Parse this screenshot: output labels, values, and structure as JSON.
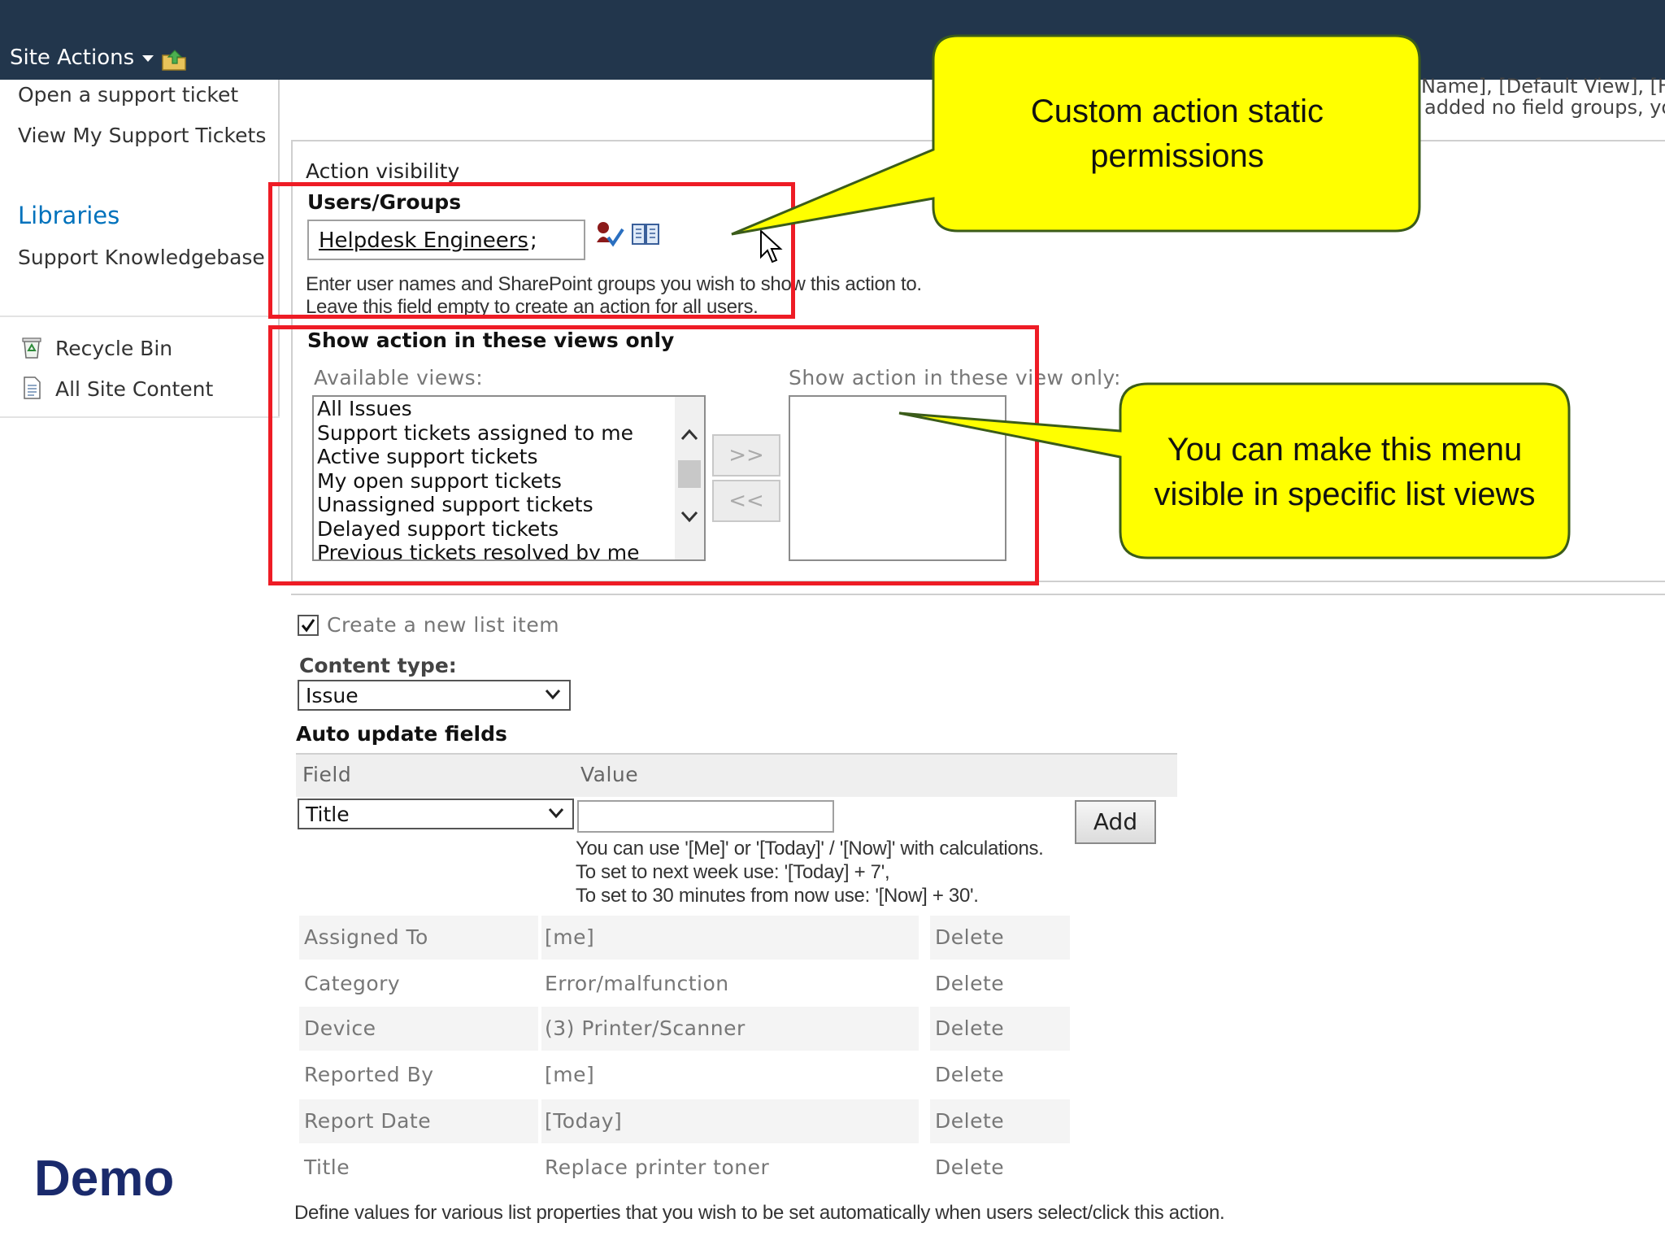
{
  "ribbon": {
    "site_actions_label": "Site Actions"
  },
  "nav": {
    "links_top": [
      "Open a support ticket",
      "View My Support Tickets"
    ],
    "libraries_heading": "Libraries",
    "library_items": [
      "Support Knowledgebase"
    ],
    "bottom_links": [
      "Recycle Bin",
      "All Site Content"
    ]
  },
  "cropped_right": {
    "line1": "Name], [Default View], [Ho",
    "line2": "added no field groups, you"
  },
  "visibility": {
    "legend": "Action visibility",
    "users_groups_label": "Users/Groups",
    "people_value": "Helpdesk Engineers",
    "people_suffix": ";",
    "hint_line1": "Enter user names and SharePoint groups you wish to show this action to.",
    "hint_line2": "Leave this field empty to create an action for all users.",
    "views_section_label": "Show action in these views only",
    "available_views_label": "Available views:",
    "selected_views_label": "Show action in these view only:",
    "available_views": [
      "All Issues",
      "Support tickets assigned to me",
      "Active support tickets",
      "My open support tickets",
      "Unassigned support tickets",
      "Delayed support tickets",
      "Previous tickets resolved by me"
    ],
    "add_button": ">>",
    "remove_button": "<<"
  },
  "callouts": {
    "permissions_line1": "Custom action static",
    "permissions_line2": "permissions",
    "views_line1": "You can  make this menu",
    "views_line2": "visible in specific list views"
  },
  "create_item": {
    "checkbox_label": "Create a new list item",
    "checked": true,
    "content_type_label": "Content type:",
    "content_type_value": "Issue",
    "auto_update_label": "Auto update fields",
    "field_header": "Field",
    "value_header": "Value",
    "field_select_value": "Title",
    "value_input": "",
    "add_button": "Add",
    "value_hint_line1": "You can use '[Me]' or '[Today]' / '[Now]' with calculations.",
    "value_hint_line2": "To set to next week use: '[Today] + 7',",
    "value_hint_line3": "To set to 30 minutes from now use: '[Now] + 30'.",
    "rows": [
      {
        "field": "Assigned To",
        "value": "[me]",
        "action": "Delete"
      },
      {
        "field": "Category",
        "value": "Error/malfunction",
        "action": "Delete"
      },
      {
        "field": "Device",
        "value": "(3) Printer/Scanner",
        "action": "Delete"
      },
      {
        "field": "Reported By",
        "value": "[me]",
        "action": "Delete"
      },
      {
        "field": "Report Date",
        "value": "[Today]",
        "action": "Delete"
      },
      {
        "field": "Title",
        "value": "Replace printer toner",
        "action": "Delete"
      }
    ],
    "footer_note": "Define values for various list properties that you wish to be set automatically when users select/click this action."
  },
  "slide_label": "Demo",
  "colors": {
    "ribbon": "#22364c",
    "highlight_border": "#ee1c25",
    "callout_fill": "#ffff00",
    "callout_border": "#3b5c1a",
    "nav_heading": "#0072bc",
    "demo_text": "#1a2a6c"
  }
}
